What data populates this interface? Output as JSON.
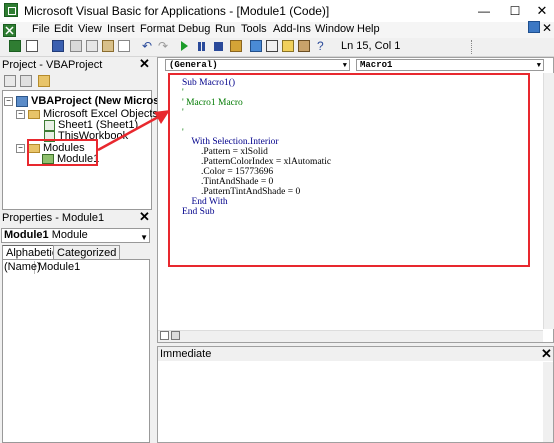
{
  "window": {
    "title": "Microsoft Visual Basic for Applications - [Module1 (Code)]",
    "min": "—",
    "max": "☐",
    "close": "✕"
  },
  "menu": [
    "File",
    "Edit",
    "View",
    "Insert",
    "Format",
    "Debug",
    "Run",
    "Tools",
    "Add-Ins",
    "Window",
    "Help"
  ],
  "toolbar": {
    "position": "Ln 15, Col 1"
  },
  "project": {
    "title": "Project - VBAProject",
    "root": "VBAProject (New Microsoft",
    "excel_objects": "Microsoft Excel Objects",
    "sheet1": "Sheet1 (Sheet1)",
    "workbook": "ThisWorkbook",
    "modules": "Modules",
    "module1": "Module1"
  },
  "properties": {
    "title": "Properties - Module1",
    "object_name": "Module1",
    "object_type": "Module",
    "tab_alpha": "Alphabetic",
    "tab_cat": "Categorized",
    "prop_name": "(Name)",
    "prop_value": "Module1"
  },
  "code": {
    "object_combo": "(General)",
    "proc_combo": "Macro1",
    "lines": {
      "l1": "Sub Macro1()",
      "l2": "'",
      "l3": "' Macro1 Macro",
      "l4": "'",
      "l5": "",
      "l6": "'",
      "l7": "    With Selection.Interior",
      "l8": "        .Pattern = xlSolid",
      "l9": "        .PatternColorIndex = xlAutomatic",
      "l10": "        .Color = 15773696",
      "l11": "        .TintAndShade = 0",
      "l12": "        .PatternTintAndShade = 0",
      "l13": "    End With",
      "l14": "End Sub"
    }
  },
  "immediate": {
    "title": "Immediate"
  },
  "colors": {
    "annotation": "#e8282e",
    "keyword": "#00008b",
    "comment": "#007a00"
  }
}
